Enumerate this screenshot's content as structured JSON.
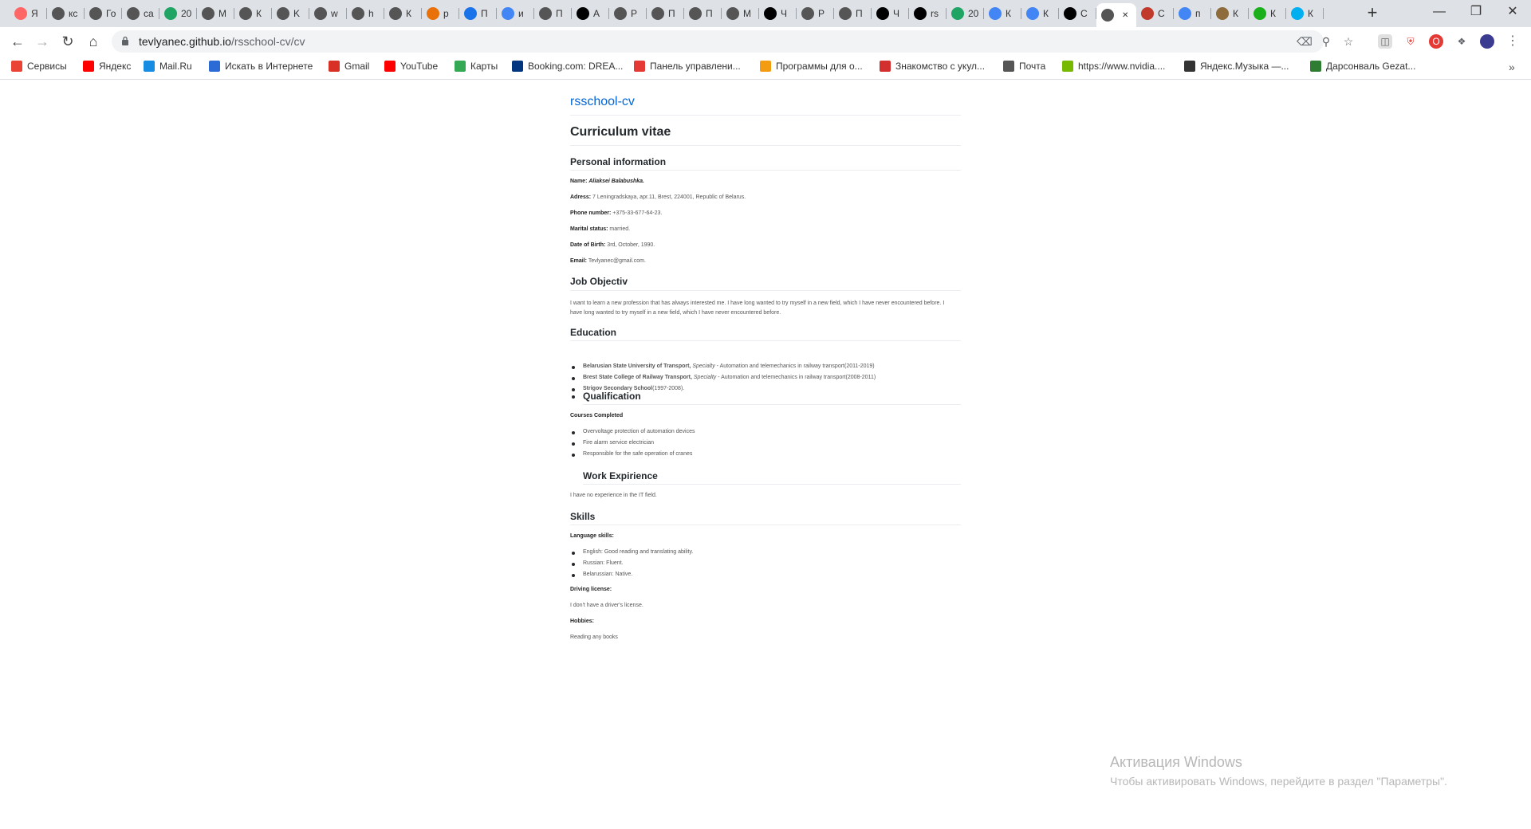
{
  "browser": {
    "tabs": [
      {
        "label": "Я",
        "icon": "yandex-tab-icon",
        "color": "#f66"
      },
      {
        "label": "кс",
        "icon": "web-globe-icon",
        "color": "#555"
      },
      {
        "label": "Го",
        "icon": "web-globe-icon",
        "color": "#555"
      },
      {
        "label": "ca",
        "icon": "web-globe-icon",
        "color": "#555"
      },
      {
        "label": "20",
        "icon": "google-drive-icon",
        "color": "#1fa463"
      },
      {
        "label": "М",
        "icon": "web-globe-icon",
        "color": "#555"
      },
      {
        "label": "К",
        "icon": "web-globe-icon",
        "color": "#555"
      },
      {
        "label": "K",
        "icon": "web-globe-icon",
        "color": "#555"
      },
      {
        "label": "w",
        "icon": "web-globe-icon",
        "color": "#555"
      },
      {
        "label": "h",
        "icon": "web-globe-icon",
        "color": "#555"
      },
      {
        "label": "К",
        "icon": "web-globe-icon",
        "color": "#555"
      },
      {
        "label": "р",
        "icon": "orange-hex-icon",
        "color": "#e8710a"
      },
      {
        "label": "П",
        "icon": "dp-tab-icon",
        "color": "#1a73e8"
      },
      {
        "label": "и",
        "icon": "google-g-icon",
        "color": "#4285f4"
      },
      {
        "label": "П",
        "icon": "web-globe-icon",
        "color": "#555"
      },
      {
        "label": "А",
        "icon": "rs-school-icon",
        "color": "#000"
      },
      {
        "label": "Р",
        "icon": "web-globe-icon",
        "color": "#555"
      },
      {
        "label": "П",
        "icon": "web-globe-icon",
        "color": "#555"
      },
      {
        "label": "П",
        "icon": "web-globe-icon",
        "color": "#555"
      },
      {
        "label": "М",
        "icon": "web-globe-icon",
        "color": "#555"
      },
      {
        "label": "Ч",
        "icon": "ya-letter-icon",
        "color": "#000"
      },
      {
        "label": "Р",
        "icon": "web-globe-icon",
        "color": "#555"
      },
      {
        "label": "П",
        "icon": "web-globe-icon",
        "color": "#555"
      },
      {
        "label": "Ч",
        "icon": "ya-letter-icon",
        "color": "#000"
      },
      {
        "label": "rs",
        "icon": "github-icon",
        "color": "#000"
      },
      {
        "label": "20",
        "icon": "google-drive-icon",
        "color": "#1fa463"
      },
      {
        "label": "К",
        "icon": "google-docs-icon",
        "color": "#4285f4"
      },
      {
        "label": "К",
        "icon": "google-docs-icon",
        "color": "#4285f4"
      },
      {
        "label": "С",
        "icon": "github-icon",
        "color": "#000"
      },
      {
        "label": "",
        "icon": "web-globe-icon",
        "color": "#555",
        "active": true
      },
      {
        "label": "С",
        "icon": "w-letter-icon",
        "color": "#c0392b"
      },
      {
        "label": "п",
        "icon": "google-g-icon",
        "color": "#4285f4"
      },
      {
        "label": "К",
        "icon": "colorful-ball-icon",
        "color": "#8e6b3a"
      },
      {
        "label": "К",
        "icon": "green-dot-icon",
        "color": "#1bb01b"
      },
      {
        "label": "К",
        "icon": "skype-icon",
        "color": "#00aff0"
      }
    ],
    "url_host": "tevlyanec.github.io",
    "url_path": "/rsschool-cv/cv",
    "bookmarks": [
      {
        "label": "Сервисы",
        "icon": "apps-grid-icon",
        "color": "#ea4335"
      },
      {
        "label": "Яндекс",
        "icon": "yandex-icon",
        "color": "#f00"
      },
      {
        "label": "Mail.Ru",
        "icon": "mailru-icon",
        "color": "#168de2"
      },
      {
        "label": "Искать в Интернете",
        "icon": "search-q-icon",
        "color": "#2a6bd5"
      },
      {
        "label": "Gmail",
        "icon": "gmail-icon",
        "color": "#d93025"
      },
      {
        "label": "YouTube",
        "icon": "youtube-icon",
        "color": "#f00"
      },
      {
        "label": "Карты",
        "icon": "maps-pin-icon",
        "color": "#34a853"
      },
      {
        "label": "Booking.com: DREA...",
        "icon": "booking-icon",
        "color": "#003580"
      },
      {
        "label": "Панель управлени...",
        "icon": "panel-icon",
        "color": "#e53935"
      },
      {
        "label": "Программы для о...",
        "icon": "orange-circle-icon",
        "color": "#f39c12"
      },
      {
        "label": "Знакомство с укул...",
        "icon": "red-circle-icon",
        "color": "#d32f2f"
      },
      {
        "label": "Почта",
        "icon": "web-globe-icon",
        "color": "#555"
      },
      {
        "label": "https://www.nvidia....",
        "icon": "nvidia-icon",
        "color": "#76b900"
      },
      {
        "label": "Яндекс.Музыка —...",
        "icon": "play-icon",
        "color": "#333"
      },
      {
        "label": "Дарсонваль Gezat...",
        "icon": "leaf-icon",
        "color": "#2e7d32"
      }
    ]
  },
  "page": {
    "site_title": "rsschool-cv",
    "cv_title": "Curriculum vitae",
    "personal": {
      "heading": "Personal information",
      "name_label": "Name:",
      "name_value": "Aliaksei Balabushka.",
      "address_label": "Adress:",
      "address_value": "7 Leningradskaya, apr.11, Brest, 224001, Republic of Belarus.",
      "phone_label": "Phone number:",
      "phone_value": "+375-33-677-64-23.",
      "marital_label": "Marital status:",
      "marital_value": "married.",
      "dob_label": "Date of Birth:",
      "dob_value": "3rd, October, 1990.",
      "email_label": "Email:",
      "email_value": "Tevlyanec@gmail.com."
    },
    "job": {
      "heading": "Job Objectiv",
      "text": "I want to learn a new profession that has always interested me. I have long wanted to try myself in a new field, which I have never encountered before. I have long wanted to try myself in a new field, which I have never encountered before."
    },
    "education": {
      "heading": "Education",
      "items": [
        {
          "name": "Belarusian State University of Transport,",
          "spec_label": "Specialty",
          "rest": " - Automation and telemechanics in railway transport(2011-2019)"
        },
        {
          "name": "Brest State College of Railway Transport,",
          "spec_label": "Specialty",
          "rest": " - Automation and telemechanics in railway transport(2008-2011)"
        },
        {
          "name": "Strigov Secondary School",
          "spec_label": "",
          "rest": "(1997-2008)."
        }
      ]
    },
    "qualification": {
      "heading": "Qualification",
      "courses_label": "Courses Completed",
      "items": [
        "Overvoltage protection of automation devices",
        "Fire alarm service electrician",
        "Responsible for the safe operation of cranes"
      ]
    },
    "work": {
      "heading": "Work Expirience",
      "text": "I have no experience in the IT field."
    },
    "skills": {
      "heading": "Skills",
      "language_label": "Language skills:",
      "languages": [
        "English: Good reading and translating ability.",
        "Russian: Fluent.",
        "Belarussian: Native."
      ],
      "driving_label": "Driving license:",
      "driving_text": "I don't have a driver's license.",
      "hobbies_label": "Hobbies:",
      "hobbies_text": "Reading any books"
    }
  },
  "watermark": {
    "title": "Активация Windows",
    "subtitle": "Чтобы активировать Windows, перейдите в раздел \"Параметры\"."
  }
}
